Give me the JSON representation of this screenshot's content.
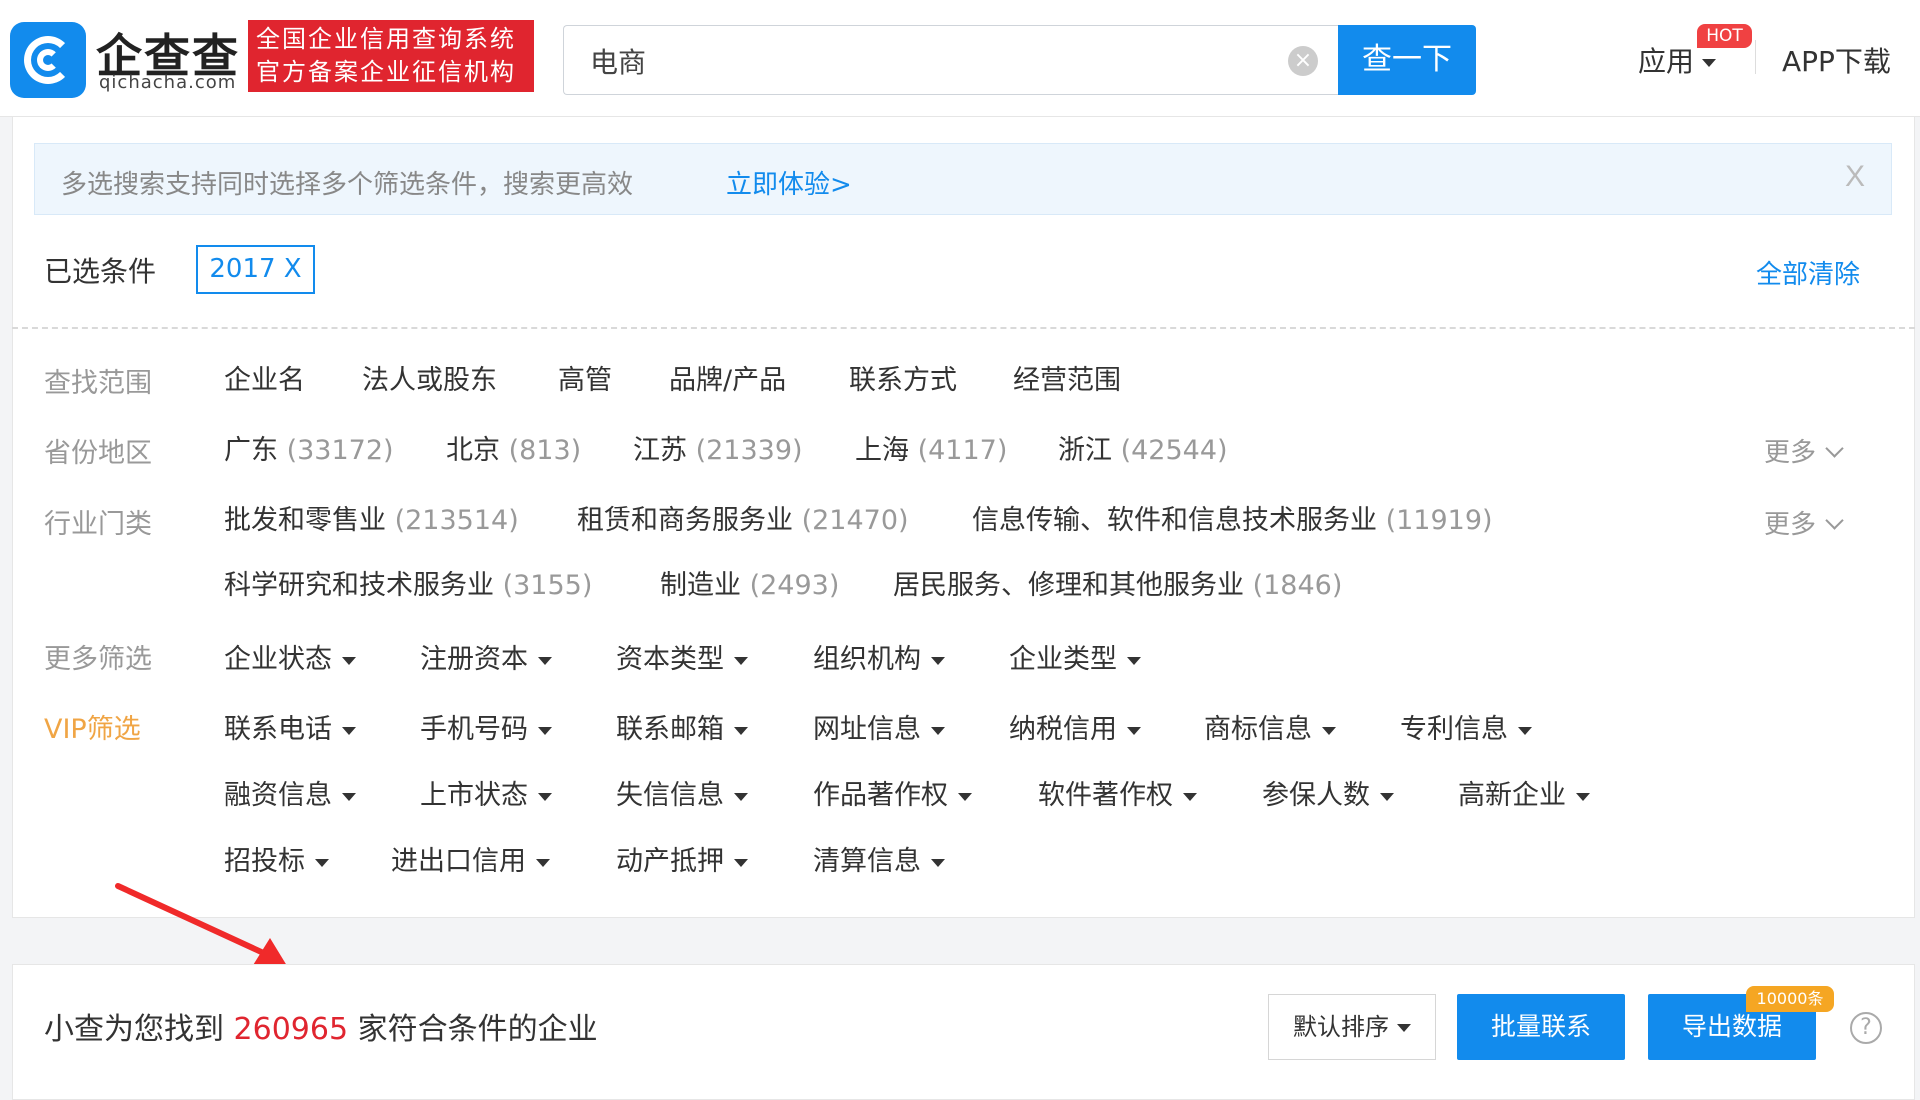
{
  "header": {
    "logo_name": "企查查",
    "logo_domain": "qichacha.com",
    "slogan_line1": "全国企业信用查询系统",
    "slogan_line2": "官方备案企业征信机构",
    "search_value": "电商",
    "search_button": "查一下",
    "nav_app": "应用",
    "hot_badge": "HOT",
    "nav_download": "APP下载"
  },
  "tip": {
    "text": "多选搜索支持同时选择多个筛选条件，搜索更高效",
    "link": "立即体验>",
    "close": "X"
  },
  "selected": {
    "label": "已选条件",
    "tag": "2017 X",
    "clear_all": "全部清除"
  },
  "filters": {
    "scope": {
      "label": "查找范围",
      "options": [
        "企业名",
        "法人或股东",
        "高管",
        "品牌/产品",
        "联系方式",
        "经营范围"
      ]
    },
    "province": {
      "label": "省份地区",
      "options": [
        {
          "name": "广东",
          "count": "(33172)"
        },
        {
          "name": "北京",
          "count": "(813)"
        },
        {
          "name": "江苏",
          "count": "(21339)"
        },
        {
          "name": "上海",
          "count": "(4117)"
        },
        {
          "name": "浙江",
          "count": "(42544)"
        }
      ],
      "more": "更多"
    },
    "industry": {
      "label": "行业门类",
      "options": [
        {
          "name": "批发和零售业",
          "count": "(213514)"
        },
        {
          "name": "租赁和商务服务业",
          "count": "(21470)"
        },
        {
          "name": "信息传输、软件和信息技术服务业",
          "count": "(11919)"
        },
        {
          "name": "科学研究和技术服务业",
          "count": "(3155)"
        },
        {
          "name": "制造业",
          "count": "(2493)"
        },
        {
          "name": "居民服务、修理和其他服务业",
          "count": "(1846)"
        }
      ],
      "more": "更多"
    },
    "more_filters": {
      "label": "更多筛选",
      "options": [
        "企业状态",
        "注册资本",
        "资本类型",
        "组织机构",
        "企业类型"
      ]
    },
    "vip": {
      "label": "VIP筛选",
      "options": [
        "联系电话",
        "手机号码",
        "联系邮箱",
        "网址信息",
        "纳税信用",
        "商标信息",
        "专利信息",
        "融资信息",
        "上市状态",
        "失信信息",
        "作品著作权",
        "软件著作权",
        "参保人数",
        "高新企业",
        "招投标",
        "进出口信用",
        "动产抵押",
        "清算信息"
      ]
    }
  },
  "result": {
    "prefix": "小查为您找到 ",
    "count": "260965",
    "suffix": " 家符合条件的企业",
    "sort_button": "默认排序",
    "bulk_button": "批量联系",
    "export_button": "导出数据",
    "export_badge": "10000条",
    "help": "?"
  },
  "colors": {
    "brand": "#128bed",
    "red": "#e0252f",
    "vip": "#f0a545"
  }
}
